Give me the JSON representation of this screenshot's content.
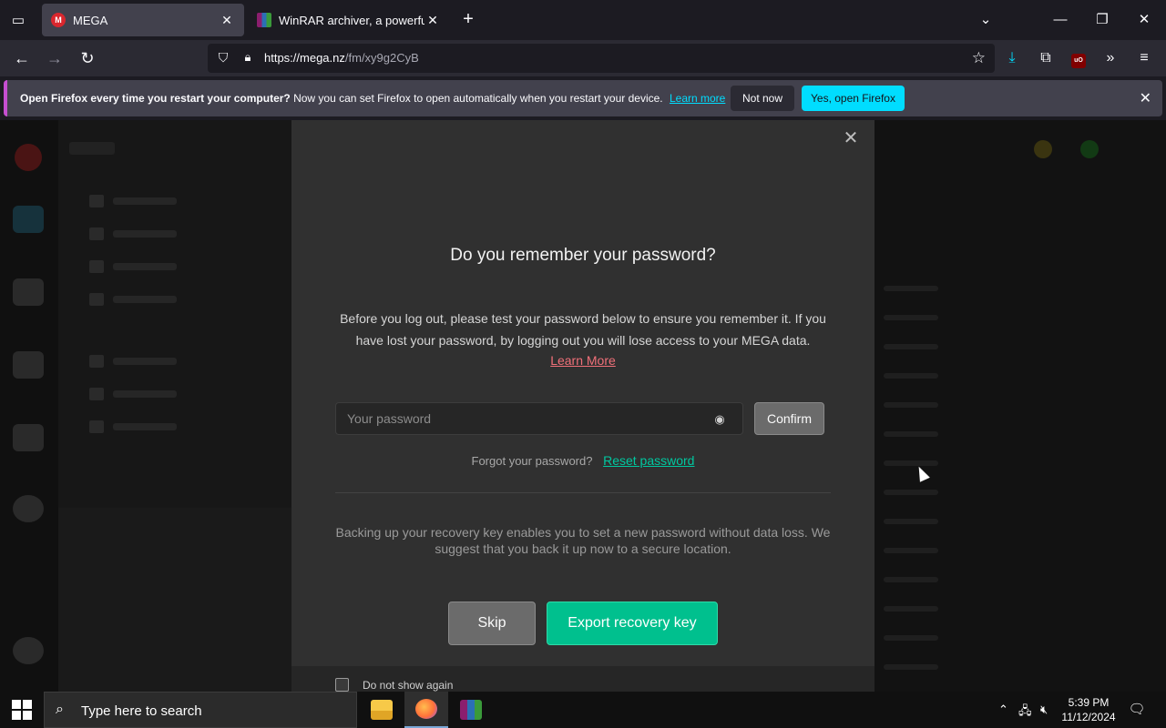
{
  "browser": {
    "tabs": [
      {
        "title": "MEGA",
        "favicon": "M",
        "active": true
      },
      {
        "title": "WinRAR archiver, a powerful to",
        "favicon": "rar",
        "active": false
      }
    ],
    "url_host": "https://mega.nz",
    "url_path": "/fm/xy9g2CyB"
  },
  "notification": {
    "bold": "Open Firefox every time you restart your computer?",
    "text": " Now you can set Firefox to open automatically when you restart your device.",
    "learn_more": "Learn more",
    "not_now": "Not now",
    "yes": "Yes, open Firefox"
  },
  "modal": {
    "title": "Do you remember your password?",
    "description": "Before you log out, please test your password below to ensure you remember it. If you have lost your password, by logging out you will lose access to your MEGA data.",
    "learn_more": "Learn More",
    "password_placeholder": "Your password",
    "confirm": "Confirm",
    "forgot_text": "Forgot your password?",
    "reset_link": "Reset password",
    "backup_text": "Backing up your recovery key enables you to set a new password without data loss. We suggest that you back it up now to a secure location.",
    "skip": "Skip",
    "export": "Export recovery key",
    "do_not_show": "Do not show again"
  },
  "taskbar": {
    "search_placeholder": "Type here to search",
    "time": "5:39 PM",
    "date": "11/12/2024"
  },
  "colors": {
    "accent_cyan": "#00ddff",
    "mega_green": "#00c08e",
    "mega_red": "#d9272e",
    "link_red": "#f07079"
  }
}
